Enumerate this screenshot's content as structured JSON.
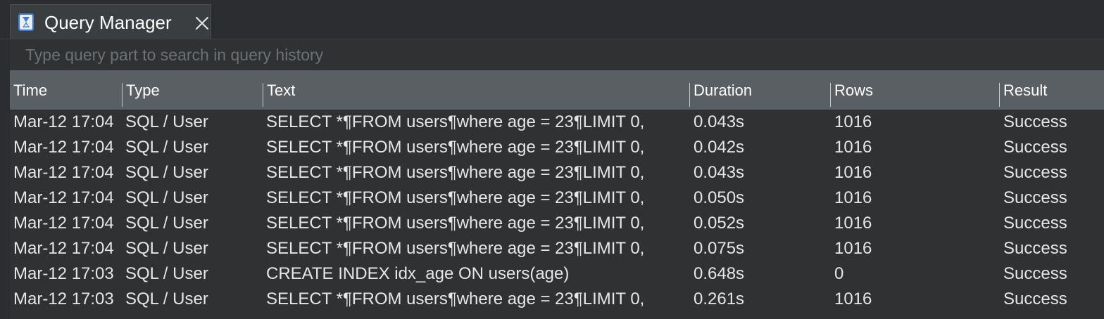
{
  "window": {
    "tab_title": "Query Manager"
  },
  "search": {
    "placeholder": "Type query part to search in query history"
  },
  "table": {
    "columns": [
      "Time",
      "Type",
      "Text",
      "Duration",
      "Rows",
      "Result"
    ],
    "rows": [
      {
        "time": "Mar-12 17:04",
        "type": "SQL / User",
        "text": "SELECT *¶FROM users¶where age = 23¶LIMIT 0,",
        "duration": "0.043s",
        "rows": "1016",
        "result": "Success"
      },
      {
        "time": "Mar-12 17:04",
        "type": "SQL / User",
        "text": "SELECT *¶FROM users¶where age = 23¶LIMIT 0,",
        "duration": "0.042s",
        "rows": "1016",
        "result": "Success"
      },
      {
        "time": "Mar-12 17:04",
        "type": "SQL / User",
        "text": "SELECT *¶FROM users¶where age = 23¶LIMIT 0,",
        "duration": "0.043s",
        "rows": "1016",
        "result": "Success"
      },
      {
        "time": "Mar-12 17:04",
        "type": "SQL / User",
        "text": "SELECT *¶FROM users¶where age = 23¶LIMIT 0,",
        "duration": "0.050s",
        "rows": "1016",
        "result": "Success"
      },
      {
        "time": "Mar-12 17:04",
        "type": "SQL / User",
        "text": "SELECT *¶FROM users¶where age = 23¶LIMIT 0,",
        "duration": "0.052s",
        "rows": "1016",
        "result": "Success"
      },
      {
        "time": "Mar-12 17:04",
        "type": "SQL / User",
        "text": "SELECT *¶FROM users¶where age = 23¶LIMIT 0,",
        "duration": "0.075s",
        "rows": "1016",
        "result": "Success"
      },
      {
        "time": "Mar-12 17:03",
        "type": "SQL / User",
        "text": "CREATE INDEX idx_age ON users(age)",
        "duration": "0.648s",
        "rows": "0",
        "result": "Success"
      },
      {
        "time": "Mar-12 17:03",
        "type": "SQL / User",
        "text": "SELECT *¶FROM users¶where age = 23¶LIMIT 0,",
        "duration": "0.261s",
        "rows": "1016",
        "result": "Success"
      }
    ]
  },
  "colors": {
    "background": "#2f3133",
    "header_background": "#5a5f63",
    "tab_icon": "#3d7bd6"
  },
  "icons": {
    "tab": "hourglass-icon",
    "close": "close-icon"
  }
}
